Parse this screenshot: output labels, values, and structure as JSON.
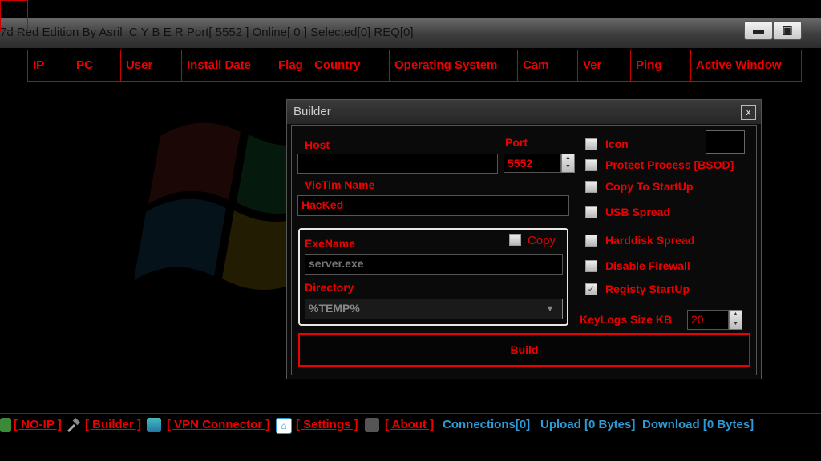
{
  "window": {
    "title": "7d Red Edition By Asril_C Y B E R    Port[ 5552 ]    Online[ 0 ]    Selected[0] REQ[0]",
    "minimize_glyph": "▬",
    "maximize_glyph": "▣"
  },
  "columns": [
    "IP",
    "PC",
    "User",
    "Install Date",
    "Flag",
    "Country",
    "Operating System",
    "Cam",
    "Ver",
    "Ping",
    "Active Window"
  ],
  "builder": {
    "title": "Builder",
    "close_glyph": "x",
    "host_label": "Host",
    "host_value": "",
    "port_label": "Port",
    "port_value": "5552",
    "victim_label": "VicTim Name",
    "victim_value": "HacKed",
    "exename_label": "ExeName",
    "copy_label": "Copy",
    "copy_checked": false,
    "exename_value": "server.exe",
    "directory_label": "Directory",
    "directory_value": "%TEMP%",
    "options": [
      {
        "label": "Icon",
        "checked": false
      },
      {
        "label": "Protect Process [BSOD]",
        "checked": false
      },
      {
        "label": "Copy To StartUp",
        "checked": false
      },
      {
        "label": "USB Spread",
        "checked": false
      },
      {
        "label": "Harddisk Spread",
        "checked": false
      },
      {
        "label": "Disable Firewall",
        "checked": false
      },
      {
        "label": "Registy StartUp",
        "checked": true
      }
    ],
    "keylogs_label": "KeyLogs Size KB",
    "keylogs_value": "20",
    "build_label": "Build"
  },
  "statusbar": {
    "noip": "[ NO-IP ]",
    "builder": "[ Builder ]",
    "vpn": "[ VPN Connector ]",
    "settings": "[ Settings ]",
    "about": "[ About ]",
    "connections": "Connections[0]",
    "upload": "Upload [0 Bytes]",
    "download": "Download [0 Bytes]"
  },
  "colors": {
    "accent": "#e00000",
    "status_blue": "#2e9bd6",
    "background": "#000000"
  }
}
